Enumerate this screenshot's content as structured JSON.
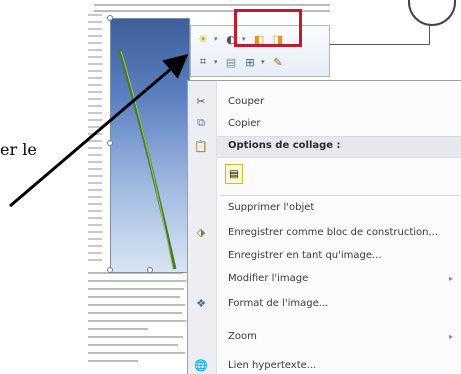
{
  "callout": {
    "text": "er le"
  },
  "mini_toolbar": {
    "highlight_color": "#c2192b"
  },
  "context_menu": {
    "cut": "Couper",
    "copy": "Copier",
    "paste_options_header": "Options de collage :",
    "delete": "Supprimer l'objet",
    "save_block": "Enregistrer comme bloc de construction...",
    "save_as_image": "Enregistrer en tant qu'image...",
    "modify_image": "Modifier l'image",
    "format_image": "Format de l'image...",
    "zoom": "Zoom",
    "hyperlink": "Lien hypertexte..."
  }
}
